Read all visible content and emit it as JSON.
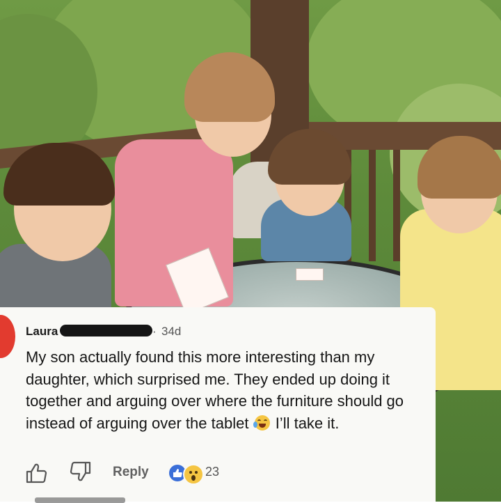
{
  "photo": {
    "description_icon": "outdoor-photo-kids-at-table"
  },
  "comment": {
    "username": "Laura",
    "separator": "·",
    "time": "34d",
    "body": "My son actually found this more interesting than my daughter, which surprised me. They ended up doing it together and arguing over where the furniture should go instead of arguing over the tablet",
    "body_after_emoji": " I’ll take it.",
    "reply_label": "Reply",
    "reaction_count": "23",
    "icons": {
      "like": "thumbs-up-icon",
      "dislike": "thumbs-down-icon",
      "reaction_like": "like-reaction-icon",
      "reaction_wow": "wow-reaction-icon",
      "emoji": "joy-emoji-icon"
    },
    "colors": {
      "card_bg": "#f9f9f6",
      "avatar": "#e23b2f",
      "like_reaction": "#3b6fd8"
    }
  }
}
